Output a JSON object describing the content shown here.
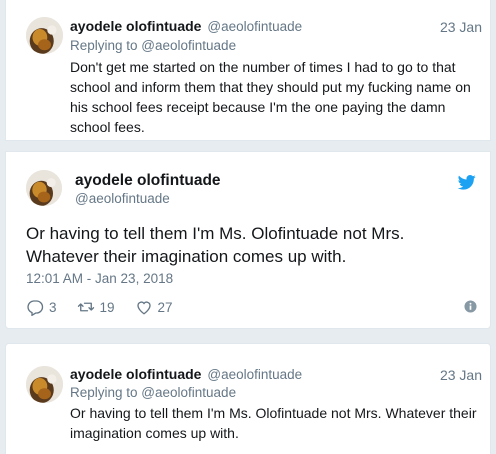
{
  "top_tweet": {
    "name": "ayodele olofintuade",
    "handle": "@aeolofintuade",
    "date": "23 Jan",
    "replying_prefix": "Replying to ",
    "replying_handle": "@aeolofintuade",
    "text": "Don't get me started on the number of times I had to go to that school and inform them that they should put my fucking name on his school fees receipt because I'm the one paying the damn school fees."
  },
  "main_tweet": {
    "name": "ayodele olofintuade",
    "handle": "@aeolofintuade",
    "text": "Or having to tell them I'm Ms. Olofintuade not Mrs. Whatever their imagination comes up with.",
    "timestamp": "12:01 AM - Jan 23, 2018",
    "replies": "3",
    "retweets": "19",
    "likes": "27",
    "brand_color": "#1da1f2"
  },
  "bottom_tweet": {
    "name": "ayodele olofintuade",
    "handle": "@aeolofintuade",
    "date": "23 Jan",
    "replying_prefix": "Replying to ",
    "replying_handle": "@aeolofintuade",
    "text": "Or having to tell them I'm Ms. Olofintuade not Mrs. Whatever their imagination comes up with."
  }
}
